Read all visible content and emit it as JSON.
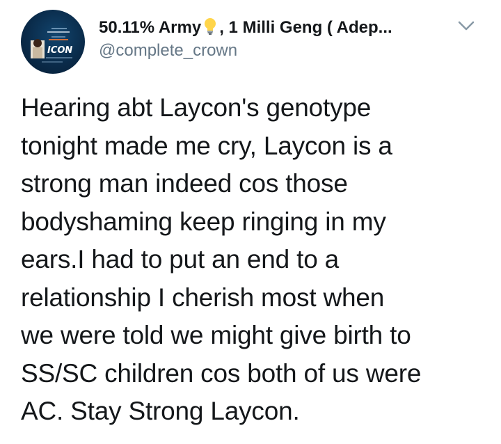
{
  "tweet": {
    "display_name_part1": "50.11% Army",
    "display_name_part2": ", 1 Milli Geng ( Adep...",
    "name_emoji": "lightbulb-icon",
    "handle": "@complete_crown",
    "menu_icon": "chevron-down-icon",
    "avatar_text": "ICON",
    "body_lines": [
      "Hearing abt Laycon's genotype",
      "tonight made me cry, Laycon is a",
      "strong man indeed cos those",
      "bodyshaming keep ringing in my",
      "ears.I had to put an end to a",
      "relationship I cherish most when",
      "we were told we might give birth to",
      "SS/SC children cos both of us were",
      "AC. Stay Strong Laycon."
    ]
  },
  "colors": {
    "text_primary": "#14171a",
    "text_secondary": "#657786",
    "chevron": "#8899a6",
    "avatar_bg": "#0a2b4a",
    "bulb": "#ffd54a"
  }
}
